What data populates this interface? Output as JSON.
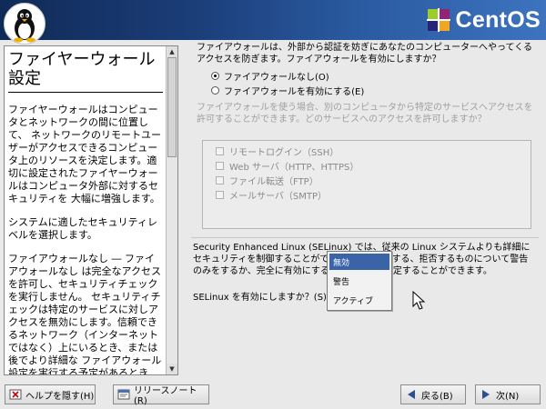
{
  "brand": {
    "name": "CentOS"
  },
  "help": {
    "title": "ファイヤーウォール設定",
    "paragraphs": [
      "ファイヤーウォールはコンピュータとネットワークの間に位置して、 ネットワークのリモートユーザーがアクセスできるコンピュータ上のリソースを決定します。適切に設定されたファイヤーウォールはコンピュータ外部に対するセキュリティを 大幅に増強します。",
      "システムに適したセキュリティレベルを選択します。",
      "ファイアウォールなし ― ファイアウォールなし は完全なアクセスを許可し、セキュリティチェックを実行しません。 セキュリティチェックは特定のサービスに対しアクセスを無効にします。信頼できるネットワーク（インターネットではなく）上にいるとき、または後でより詳細な ファイアウォール設定を実行する予定があるとき"
    ]
  },
  "firewall": {
    "question": "ファイアウォールは、外部から認証を妨ぎにあなたのコンピューターへやってくるアクセスを防ぎます。ファイアウォールを有効にしますか？",
    "options": [
      {
        "label": "ファイアウォールなし(O)",
        "selected": true
      },
      {
        "label": "ファイアウォールを有効にする(E)",
        "selected": false
      }
    ],
    "services_description": "ファイアウォールを使う場合、別のコンピュータから特定のサービスへアクセスを許可することができます。どのサービスへのアクセスを許可しますか？",
    "services": [
      {
        "label": "リモートログイン（SSH）",
        "checked": false
      },
      {
        "label": "Web サーバ（HTTP、HTTPS）",
        "checked": false
      },
      {
        "label": "ファイル転送（FTP）",
        "checked": false
      },
      {
        "label": "メールサーバ（SMTP）",
        "checked": false
      }
    ]
  },
  "selinux": {
    "description": "Security Enhanced Linux (SELinux) では、従来の Linux システムよりも詳細にセキュリティを制御することができます。無効にする、拒否するものについて警告のみをするか、完全に有効にするなどの状態に設定することができます。",
    "prompt": "SELinux を有効にしますか？(S)",
    "options": [
      "無効",
      "警告",
      "アクティブ"
    ],
    "selected_option": "無効"
  },
  "buttons": {
    "hide_help": "ヘルプを隠す(H)",
    "release_notes": "リリースノート(R)",
    "back": "戻る(B)",
    "next": "次(N)"
  },
  "colors": {
    "header_dark": "#0f2a56",
    "header_light": "#3d73bf",
    "selection": "#3a63a8",
    "disabled_text": "#8a8a8a"
  }
}
